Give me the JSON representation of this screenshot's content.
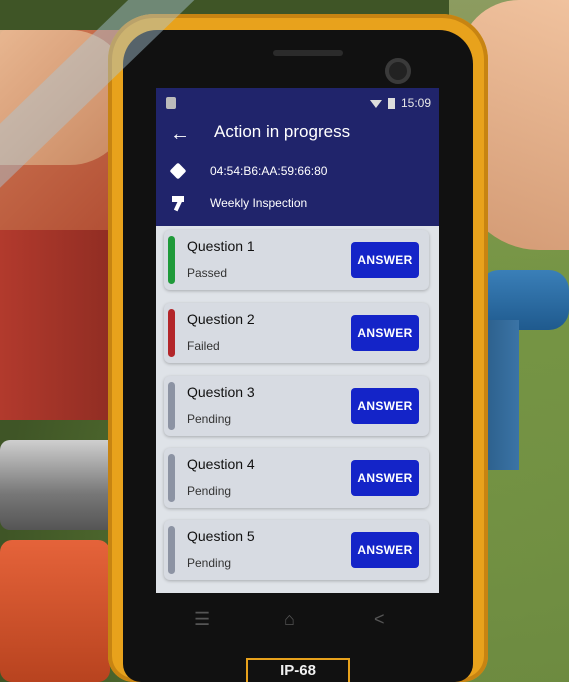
{
  "status": {
    "time": "15:09"
  },
  "header": {
    "title": "Action in progress",
    "mac": "04:54:B6:AA:59:66:80",
    "inspection": "Weekly Inspection"
  },
  "questions": [
    {
      "label": "Question 1",
      "status": "Passed",
      "button": "ANSWER",
      "color": "#1f9a3a"
    },
    {
      "label": "Question 2",
      "status": "Failed",
      "button": "ANSWER",
      "color": "#b3262a"
    },
    {
      "label": "Question 3",
      "status": "Pending",
      "button": "ANSWER",
      "color": "#8c93a3"
    },
    {
      "label": "Question 4",
      "status": "Pending",
      "button": "ANSWER",
      "color": "#8c93a3"
    },
    {
      "label": "Question 5",
      "status": "Pending",
      "button": "ANSWER",
      "color": "#8c93a3"
    }
  ],
  "device": {
    "badge": "IP-68"
  },
  "icons": {
    "back": "back-arrow-icon",
    "tag": "tag-icon",
    "hammer": "hammer-icon",
    "wifi": "wifi-icon",
    "battery": "battery-icon",
    "menu": "menu-icon",
    "home": "home-icon",
    "back_nav": "back-nav-icon"
  },
  "colors": {
    "header_bg": "#20246b",
    "button": "#1424c8",
    "screen_bg": "#dfe3e8",
    "phone_body": "#e8a21c"
  }
}
